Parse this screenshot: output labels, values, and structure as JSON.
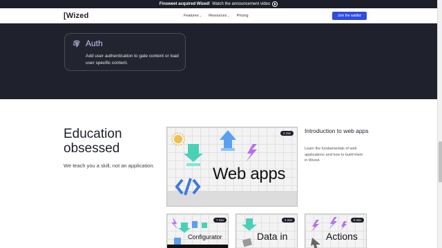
{
  "announcement": {
    "prefix": "Finsweet acquired Wized!",
    "suffix": "Watch the announcement video"
  },
  "nav": {
    "logo": "[Wized",
    "links": [
      {
        "label": "Features",
        "caret": "⌄"
      },
      {
        "label": "Resources",
        "caret": "⌄"
      },
      {
        "label": "Pricing"
      }
    ],
    "cta": "Join the waitlist"
  },
  "auth": {
    "title": "Auth",
    "description": "Add user authentication to gate content or load user specific content."
  },
  "education": {
    "title": "Education obsessed",
    "subtitle": "We teach you a skill, not an application."
  },
  "courses": {
    "main": {
      "label": "Web apps",
      "duration": "2 min"
    },
    "side_title": "Introduction to web apps",
    "side_description": "Learn the fundamentals of web applications and how to build them in Wized.",
    "cards": [
      {
        "label": "Configurator",
        "duration": "7 min"
      },
      {
        "label": "Data in",
        "duration": "4 min"
      },
      {
        "label": "Actions",
        "duration": "5 min"
      }
    ]
  },
  "colors": {
    "brand_blue": "#2e4ce6",
    "dark_bg": "#1f222d",
    "auth_accent": "#c8c6f0"
  }
}
